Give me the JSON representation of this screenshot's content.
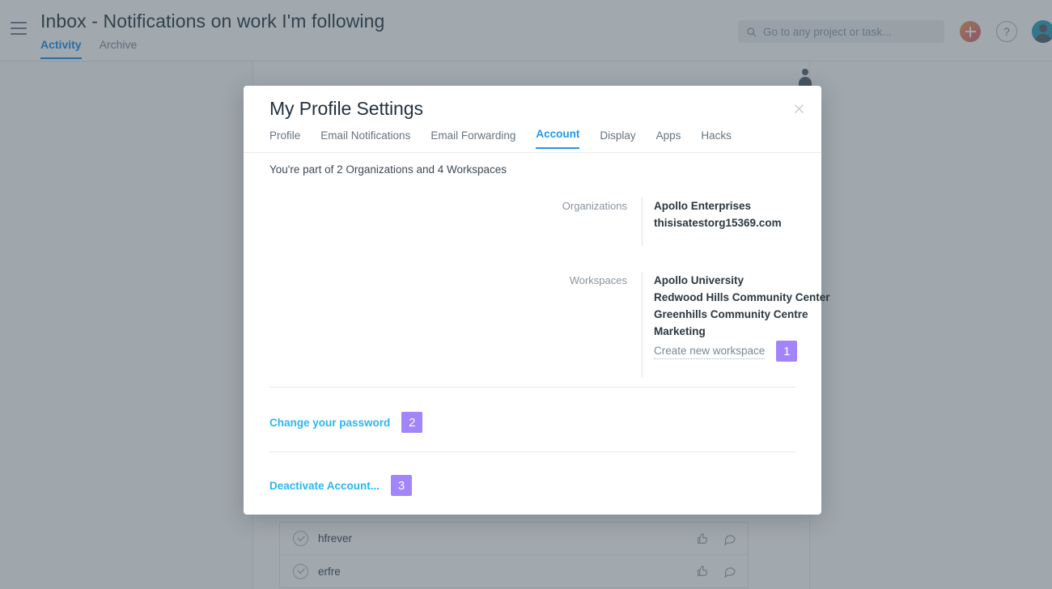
{
  "app": {
    "menu_icon": "hamburger-icon",
    "page_title": "Inbox - Notifications on work I'm following",
    "tabs": [
      {
        "label": "Activity",
        "active": true
      },
      {
        "label": "Archive",
        "active": false
      }
    ],
    "search": {
      "icon": "search-icon",
      "placeholder": "Go to any project or task..."
    },
    "add_button_icon": "plus-icon",
    "help_button_label": "?",
    "avatar_icon": "user-avatar",
    "accent_blue": "#2196f3",
    "add_button_color": "#e8845f"
  },
  "background_list": {
    "rows": [
      {
        "name": "hfrever",
        "check_icon": "check-circle-icon",
        "like_icon": "thumbs-up-icon",
        "comment_icon": "comment-icon"
      },
      {
        "name": "erfre",
        "check_icon": "check-circle-icon",
        "like_icon": "thumbs-up-icon",
        "comment_icon": "comment-icon"
      }
    ]
  },
  "modal": {
    "title": "My Profile Settings",
    "close_icon": "close-icon",
    "tabs": [
      {
        "label": "Profile",
        "active": false
      },
      {
        "label": "Email Notifications",
        "active": false
      },
      {
        "label": "Email Forwarding",
        "active": false
      },
      {
        "label": "Account",
        "active": true
      },
      {
        "label": "Display",
        "active": false
      },
      {
        "label": "Apps",
        "active": false
      },
      {
        "label": "Hacks",
        "active": false
      }
    ],
    "summary": "You're part of 2 Organizations and 4 Workspaces",
    "organizations": {
      "label": "Organizations",
      "items": [
        "Apollo Enterprises",
        "thisisatestorg15369.com"
      ]
    },
    "workspaces": {
      "label": "Workspaces",
      "items": [
        "Apollo University",
        "Redwood Hills Community Center",
        "Greenhills Community Centre",
        "Marketing"
      ],
      "create_link": "Create new workspace",
      "create_badge": "1"
    },
    "actions": [
      {
        "label": "Change your password",
        "badge": "2"
      },
      {
        "label": "Deactivate Account...",
        "badge": "3"
      }
    ],
    "badge_color": "#a285fa",
    "link_color": "#29b6f6"
  }
}
